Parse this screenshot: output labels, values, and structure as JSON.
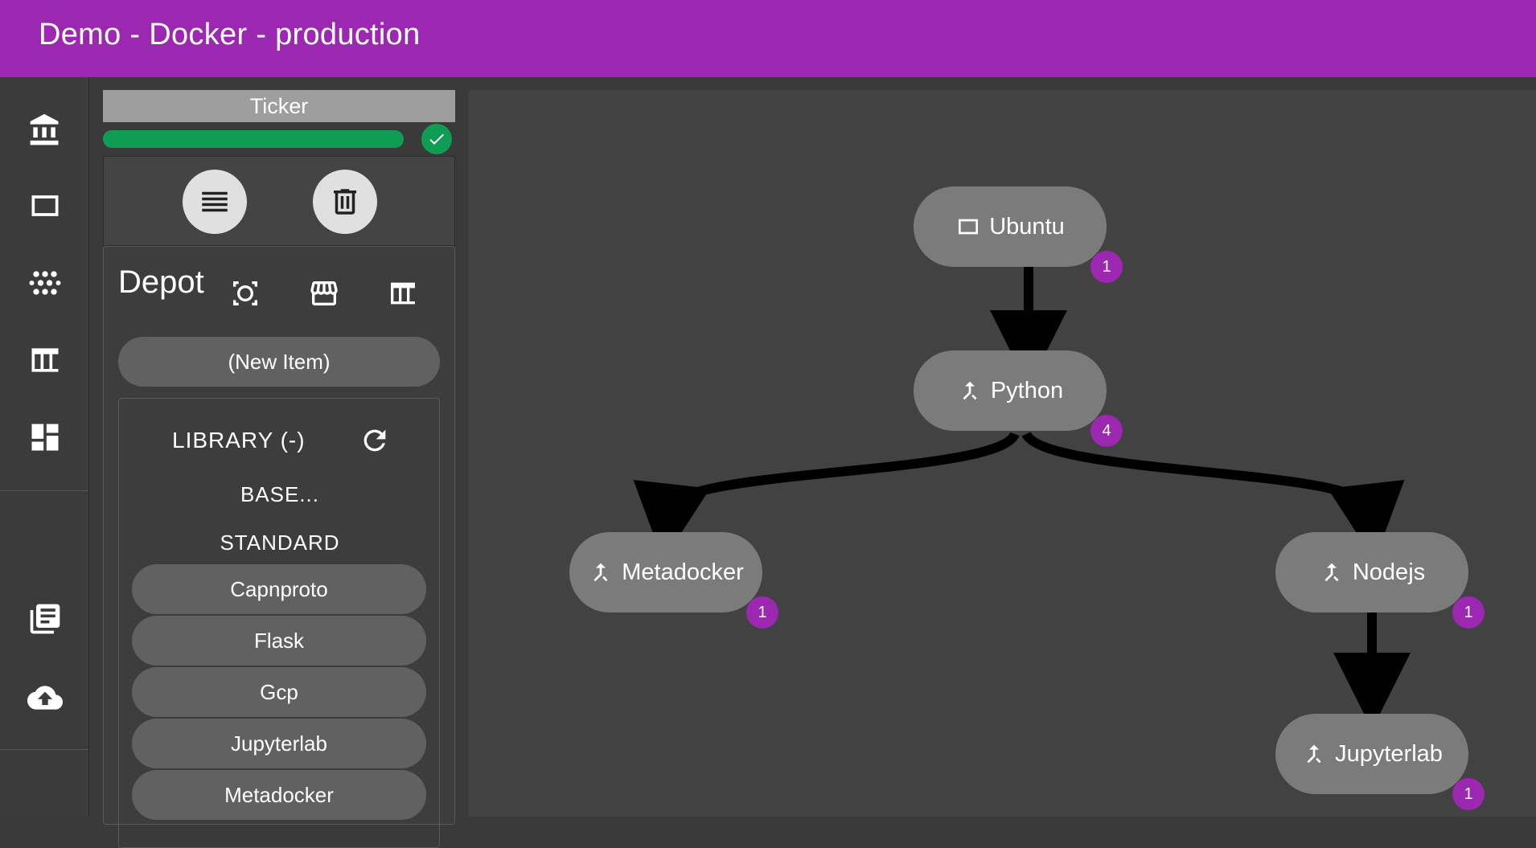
{
  "app": {
    "title": "Demo - Docker - production"
  },
  "rail": {
    "top_icons": [
      "bank-icon",
      "square-icon",
      "dots-icon",
      "table-icon",
      "dashboard-icon"
    ],
    "bottom_icons": [
      "library-books-icon",
      "cloud-upload-icon"
    ]
  },
  "ticker": {
    "label": "Ticker",
    "progress_percent": 100,
    "status": "complete",
    "status_color": "#0e9d52"
  },
  "actions": {
    "buttons": [
      "list-icon",
      "trash-icon"
    ]
  },
  "depot": {
    "title": "Depot",
    "icons": [
      "focus-icon",
      "store-icon",
      "table-icon"
    ],
    "new_item_label": "(New Item)",
    "library": {
      "header": "LIBRARY (-)",
      "categories": [
        "BASE...",
        "STANDARD"
      ],
      "items": [
        "Capnproto",
        "Flask",
        "Gcp",
        "Jupyterlab",
        "Metadocker"
      ]
    }
  },
  "graph": {
    "nodes": [
      {
        "id": "ubuntu",
        "label": "Ubuntu",
        "icon": "square-icon",
        "badge": "1"
      },
      {
        "id": "python",
        "label": "Python",
        "icon": "merge-icon",
        "badge": "4"
      },
      {
        "id": "metadocker",
        "label": "Metadocker",
        "icon": "merge-icon",
        "badge": "1"
      },
      {
        "id": "nodejs",
        "label": "Nodejs",
        "icon": "merge-icon",
        "badge": "1"
      },
      {
        "id": "jupyterlab",
        "label": "Jupyterlab",
        "icon": "merge-icon",
        "badge": "1"
      }
    ],
    "edges": [
      [
        "ubuntu",
        "python"
      ],
      [
        "python",
        "metadocker"
      ],
      [
        "python",
        "nodejs"
      ],
      [
        "nodejs",
        "jupyterlab"
      ]
    ],
    "colors": {
      "node": "#7b7b7b",
      "badge": "#9c27b0",
      "edge": "#000000"
    }
  }
}
